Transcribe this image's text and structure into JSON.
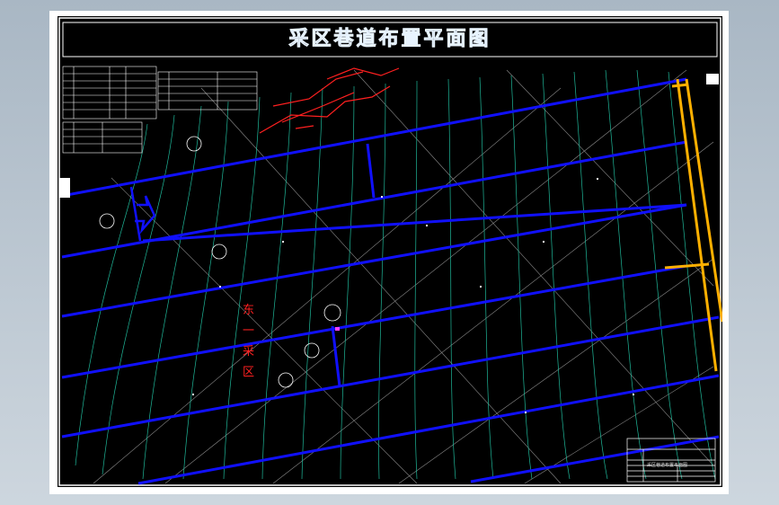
{
  "drawing": {
    "title": "采区巷道布置平面图",
    "zone_label_chars": [
      "东",
      "一",
      "采",
      "区"
    ],
    "title_block_text": "采区巷道布置平面图"
  },
  "colors": {
    "background": "#000000",
    "roadway": "#1010ff",
    "contour": "#1fb89a",
    "fault": "#ff2020",
    "main_roadway": "#ffb000",
    "grid": "#8a8a8a",
    "annotation": "#ffffff"
  },
  "icons": {
    "flow_arrow": "airflow-arrow-icon",
    "symbol": "survey-point-icon"
  }
}
